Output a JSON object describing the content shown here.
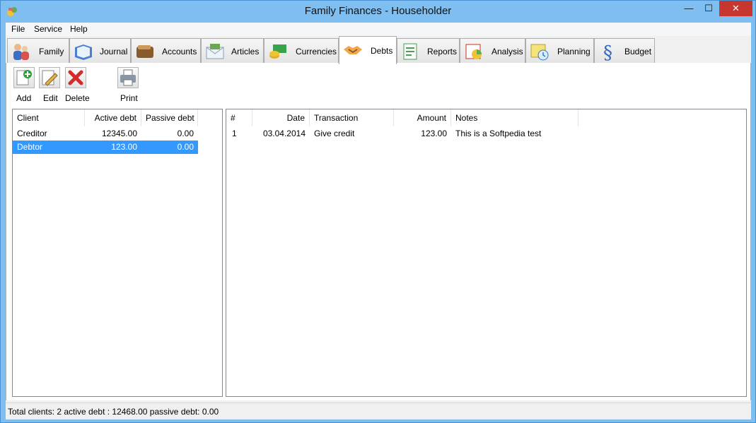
{
  "window": {
    "title": "Family Finances - Householder",
    "minimize_glyph": "—",
    "maximize_glyph": "☐",
    "close_glyph": "✕"
  },
  "menu": {
    "items": [
      {
        "label": "File"
      },
      {
        "label": "Service"
      },
      {
        "label": "Help"
      }
    ]
  },
  "tabs": [
    {
      "label": "Family",
      "icon": "family-icon"
    },
    {
      "label": "Journal",
      "icon": "journal-icon"
    },
    {
      "label": "Accounts",
      "icon": "wallet-icon"
    },
    {
      "label": "Articles",
      "icon": "money-envelope-icon"
    },
    {
      "label": "Currencies",
      "icon": "currency-icon"
    },
    {
      "label": "Debts",
      "icon": "handshake-icon",
      "active": true
    },
    {
      "label": "Reports",
      "icon": "report-icon"
    },
    {
      "label": "Analysis",
      "icon": "analysis-chart-icon"
    },
    {
      "label": "Planning",
      "icon": "calendar-clock-icon"
    },
    {
      "label": "Budget",
      "icon": "section-sign-icon"
    }
  ],
  "toolbar": {
    "add_label": "Add",
    "edit_label": "Edit",
    "delete_label": "Delete",
    "print_label": "Print"
  },
  "clients_grid": {
    "columns": [
      "Client",
      "Active debt",
      "Passive debt"
    ],
    "rows": [
      {
        "client": "Creditor",
        "active": "12345.00",
        "passive": "0.00",
        "selected": false
      },
      {
        "client": "Debtor",
        "active": "123.00",
        "passive": "0.00",
        "selected": true
      }
    ]
  },
  "transactions_grid": {
    "columns": [
      "#",
      "Date",
      "Transaction",
      "Amount",
      "Notes"
    ],
    "rows": [
      {
        "num": "1",
        "date": "03.04.2014",
        "transaction": "Give credit",
        "amount": "123.00",
        "notes": "This is a Softpedia test"
      }
    ]
  },
  "status": {
    "text": "Total clients: 2   active debt : 12468.00    passive debt: 0.00"
  },
  "colors": {
    "selection": "#3399ff",
    "title_bar": "#7ebef0",
    "close_button": "#c7372f"
  }
}
